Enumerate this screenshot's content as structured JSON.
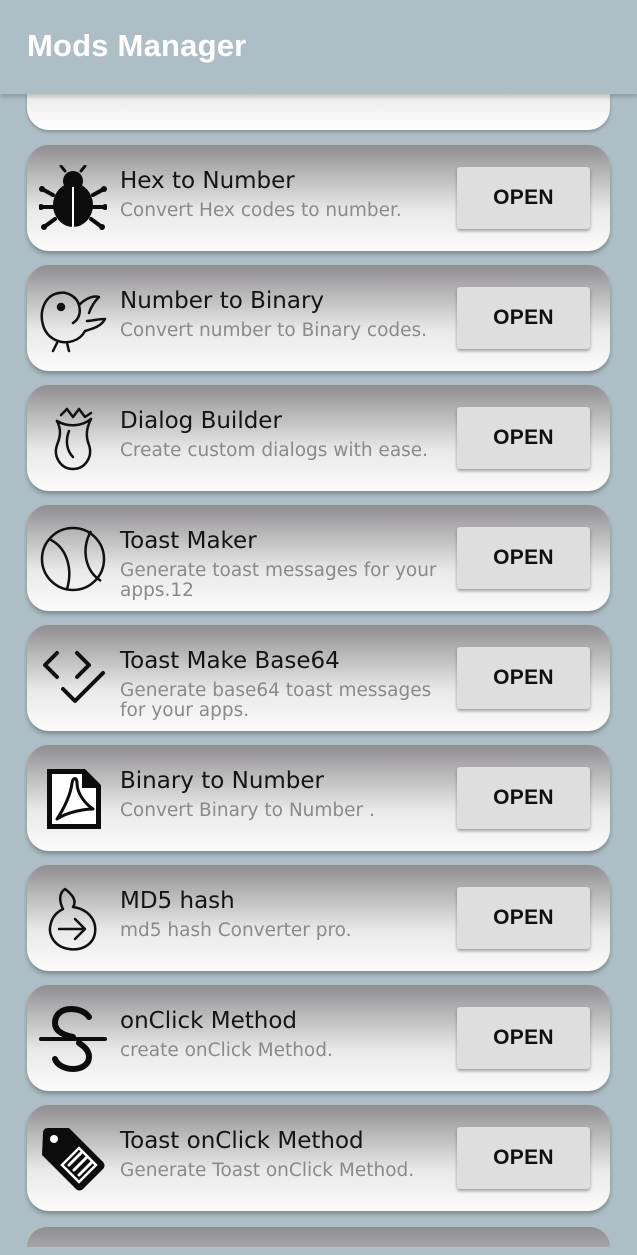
{
  "appbar": {
    "title": "Mods Manager"
  },
  "items": [
    {
      "title": "Hex to Number",
      "subtitle": "Convert Hex codes to number.",
      "button": "OPEN",
      "icon": "bug-icon"
    },
    {
      "title": "Number to Binary",
      "subtitle": "Convert number to Binary codes.",
      "button": "OPEN",
      "icon": "bird-icon"
    },
    {
      "title": "Dialog Builder",
      "subtitle": "Create custom dialogs with ease.",
      "button": "OPEN",
      "icon": "rose-icon"
    },
    {
      "title": "Toast Maker",
      "subtitle": "Generate toast messages for your apps.12",
      "button": "OPEN",
      "icon": "ball-icon"
    },
    {
      "title": "Toast Make Base64",
      "subtitle": "Generate base64 toast messages for your apps.",
      "button": "OPEN",
      "icon": "code-check-icon"
    },
    {
      "title": "Binary to Number",
      "subtitle": "Convert Binary to Number .",
      "button": "OPEN",
      "icon": "pdf-icon"
    },
    {
      "title": "MD5 hash",
      "subtitle": "md5 hash Converter pro.",
      "button": "OPEN",
      "icon": "hand-arrow-icon"
    },
    {
      "title": "onClick Method",
      "subtitle": "create onClick Method.",
      "button": "OPEN",
      "icon": "strikethrough-s-icon"
    },
    {
      "title": "Toast onClick Method",
      "subtitle": "Generate Toast onClick Method.",
      "button": "OPEN",
      "icon": "tag-icon"
    }
  ]
}
